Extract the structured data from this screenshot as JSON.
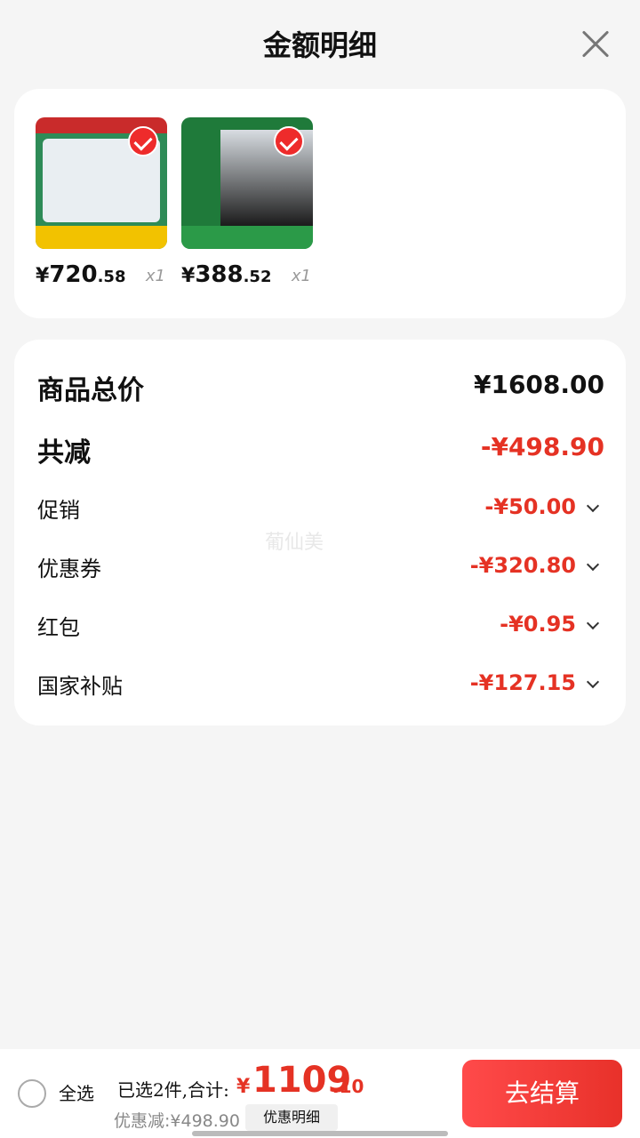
{
  "header": {
    "title": "金额明细"
  },
  "products": [
    {
      "currency": "¥",
      "price_int": "720",
      "price_dec": ".58",
      "qty": "x1"
    },
    {
      "currency": "¥",
      "price_int": "388",
      "price_dec": ".52",
      "qty": "x1"
    }
  ],
  "summary": {
    "total_label": "商品总价",
    "total_value": "¥1608.00",
    "discount_label": "共减",
    "discount_value": "-¥498.90",
    "items": [
      {
        "label": "促销",
        "value": "-¥50.00"
      },
      {
        "label": "优惠券",
        "value": "-¥320.80"
      },
      {
        "label": "红包",
        "value": "-¥0.95"
      },
      {
        "label": "国家补贴",
        "value": "-¥127.15"
      }
    ],
    "watermark": "葡仙美"
  },
  "footer": {
    "select_all": "全选",
    "selected_text": "已选2件,合计:",
    "total_symbol": "¥",
    "total_int": "1109",
    "total_dec": ".10",
    "discount_text": "优惠减:¥498.90",
    "detail_link": "优惠明细",
    "checkout_label": "去结算"
  },
  "colors": {
    "accent_red": "#e53224",
    "checkout_gradient": "#ff4a4a"
  },
  "icons": [
    "close-icon",
    "check-icon",
    "chevron-down-icon",
    "radio-icon"
  ]
}
